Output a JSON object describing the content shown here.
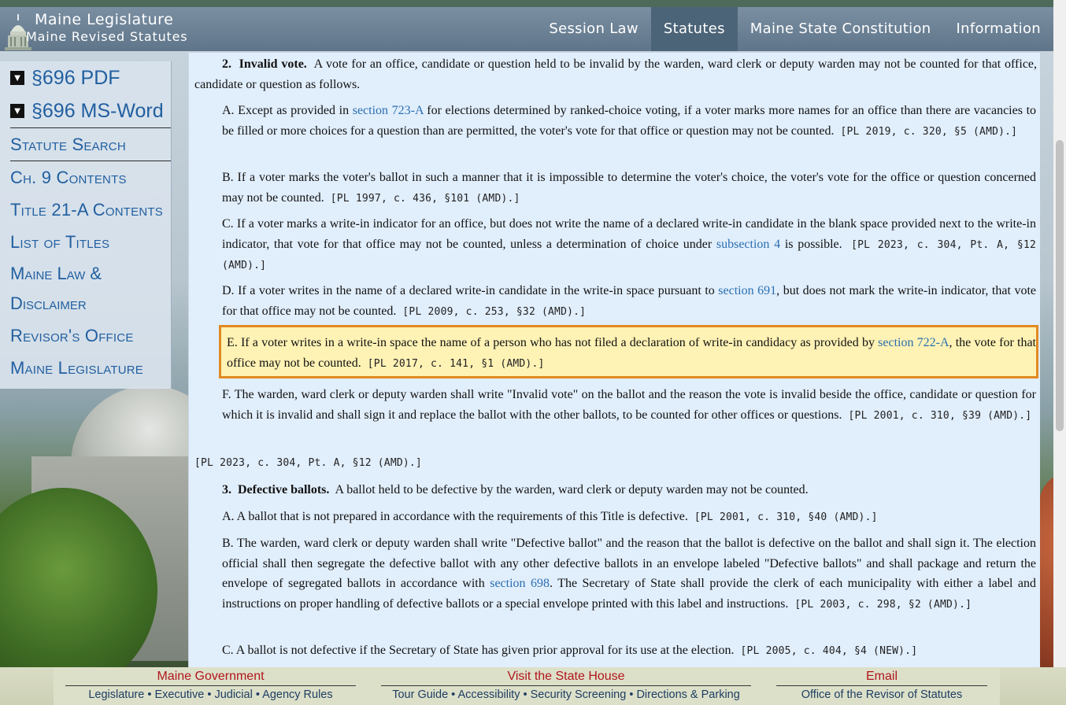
{
  "header": {
    "title": "Maine Legislature",
    "subtitle": "Maine Revised Statutes",
    "nav": [
      "Session Law",
      "Statutes",
      "Maine State Constitution",
      "Information"
    ],
    "active_nav": "Statutes"
  },
  "sidebar": {
    "pdf": "§696 PDF",
    "word": "§696 MS-Word",
    "items": [
      "Statute Search",
      "Ch. 9 Contents",
      "Title 21-A Contents",
      "List of Titles",
      "Maine Law &",
      "Disclaimer",
      "Revisor's Office",
      "Maine Legislature"
    ]
  },
  "content": {
    "s2_num": "2.",
    "s2_title": "Invalid vote.",
    "s2_text": "A vote for an office, candidate or question held to be invalid by the warden, ward clerk or deputy warden may not be counted for that office, candidate or question as follows.",
    "a_pre": "A. Except as provided in",
    "a_link": "section 723-A",
    "a_post": "for elections determined by ranked-choice voting, if a voter marks more names for an office than there are vacancies to be filled or more choices for a question than are permitted, the voter's vote for that office or question may not be counted.",
    "a_hist": "[PL 2019, c. 320, §5 (AMD).]",
    "b_text": "B. If a voter marks the voter's ballot in such a manner that it is impossible to determine the voter's choice, the voter's vote for the office or question concerned may not be counted.",
    "b_hist": "[PL 1997, c. 436, §101 (AMD).]",
    "c_pre": "C. If a voter marks a write-in indicator for an office, but does not write the name of a declared write-in candidate in the blank space provided next to the write-in indicator, that vote for that office may not be counted, unless a determination of choice under",
    "c_link": "subsection 4",
    "c_post": "is possible.",
    "c_hist": "[PL 2023, c. 304, Pt. A, §12 (AMD).]",
    "d_pre": "D. If a voter writes in the name of a declared write-in candidate in the write-in space pursuant to",
    "d_link": "section 691",
    "d_post": ", but does not mark the write-in indicator, that vote for that office may not be counted.",
    "d_hist": "[PL 2009, c. 253, §32 (AMD).]",
    "e_pre": "E. If a voter writes in a write-in space the name of a person who has not filed a declaration of write-in candidacy as provided by",
    "e_link": "section 722-A",
    "e_post": ", the vote for that office may not be counted.",
    "e_hist": "[PL 2017, c. 141, §1 (AMD).]",
    "f_text": "F. The warden, ward clerk or deputy warden shall write \"Invalid vote\" on the ballot and the reason the vote is invalid beside the office, candidate or question for which it is invalid and shall sign it and replace the ballot with the other ballots, to be counted for other offices or questions.",
    "f_hist": "[PL 2001, c. 310, §39 (AMD).]",
    "s2_hist": "[PL 2023, c. 304, Pt. A, §12 (AMD).]",
    "s3_num": "3.",
    "s3_title": "Defective ballots.",
    "s3_text": "A ballot held to be defective by the warden, ward clerk or deputy warden may not be counted.",
    "s3a_text": "A. A ballot that is not prepared in accordance with the requirements of this Title is defective.",
    "s3a_hist": "[PL 2001, c. 310, §40 (AMD).]",
    "s3b_pre": "B. The warden, ward clerk or deputy warden shall write \"Defective ballot\" and the reason that the ballot is defective on the ballot and shall sign it. The election official shall then segregate the defective ballot with any other defective ballots in an envelope labeled \"Defective ballots\" and shall package and return the envelope of segregated ballots in accordance with",
    "s3b_link": "section 698",
    "s3b_post": ". The Secretary of State shall provide the clerk of each municipality with either a label and instructions on proper handling of defective ballots or a special envelope printed with this label and instructions.",
    "s3b_hist": "[PL 2003, c. 298, §2 (AMD).]",
    "s3c_text": "C. A ballot is not defective if the Secretary of State has given prior approval for its use at the election.",
    "s3c_hist": "[PL 2005, c. 404, §4 (NEW).]"
  },
  "footer": {
    "gov_title": "Maine Government",
    "gov_links": [
      "Legislature",
      "Executive",
      "Judicial",
      "Agency Rules"
    ],
    "visit_title": "Visit the State House",
    "visit_links": [
      "Tour Guide",
      "Accessibility",
      "Security Screening",
      "Directions & Parking"
    ],
    "email_title": "Email",
    "email_link": "Office of the Revisor of Statutes",
    "separator": "•"
  },
  "colors": {
    "link": "#2a6fb0",
    "highlight_bg": "#fff2b5",
    "highlight_border": "#e08a22",
    "footer_heading": "#b0161c"
  }
}
